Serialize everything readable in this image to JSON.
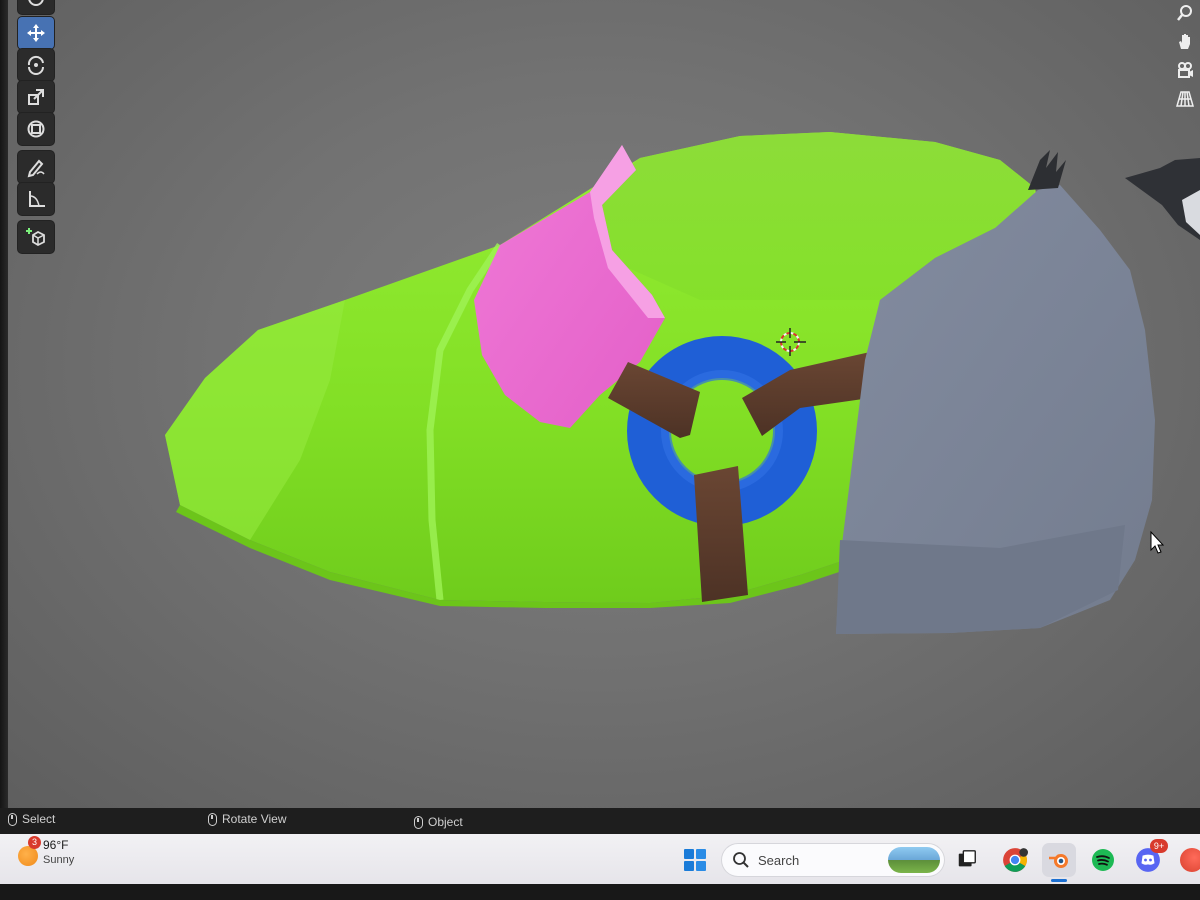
{
  "toolbar": {
    "tools": [
      {
        "name": "move-tool",
        "active": true
      },
      {
        "name": "rotate-tool",
        "active": false
      },
      {
        "name": "scale-tool",
        "active": false
      },
      {
        "name": "transform-tool",
        "active": false
      },
      {
        "name": "annotate-tool",
        "active": false
      },
      {
        "name": "measure-tool",
        "active": false
      },
      {
        "name": "add-cube-tool",
        "active": false
      }
    ],
    "active_color": "#4772b3"
  },
  "navigation_gizmo": [
    "zoom-icon",
    "hand-pan-icon",
    "camera-view-icon",
    "perspective-grid-icon"
  ],
  "scene": {
    "colors": {
      "green_body": "#8ae62a",
      "pink_panel": "#ea6bcf",
      "blue_ring": "#1f5fd6",
      "brown_straps": "#5a3b2c",
      "gray_cap": "#7e8799"
    }
  },
  "statusbar": {
    "select_label": "Select",
    "rotate_label": "Rotate View",
    "object_label": "Object"
  },
  "taskbar": {
    "weather": {
      "temperature": "96°F",
      "condition": "Sunny",
      "badge_count": "3"
    },
    "search": {
      "placeholder": "Search"
    },
    "discord_badge": "9+",
    "apps": [
      "windows-start-icon",
      "search-icon",
      "task-view-icon",
      "chrome-icon",
      "blender-icon",
      "spotify-icon",
      "discord-icon"
    ]
  }
}
